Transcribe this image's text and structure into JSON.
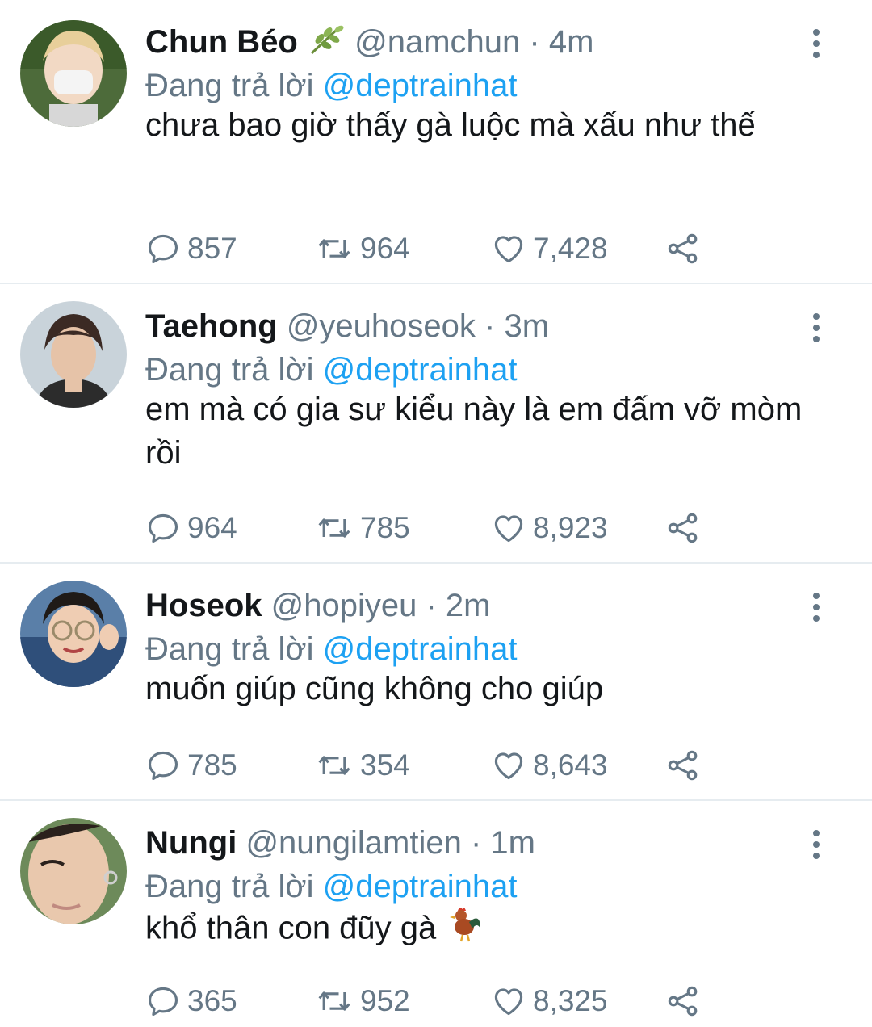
{
  "reply_prefix": "Đang trả lời",
  "tweets": [
    {
      "name": "Chun Béo",
      "name_emoji": "herb-emoji",
      "handle": "@namchun",
      "time": "· 4m",
      "mention": "@deptrainhat",
      "text": "chưa bao giờ thấy gà luộc mà xấu như thế",
      "replies": "857",
      "retweets": "964",
      "likes": "7,428"
    },
    {
      "name": "Taehong",
      "handle": "@yeuhoseok",
      "time": "· 3m",
      "mention": "@deptrainhat",
      "text": "em mà có gia sư kiểu này là em đấm vỡ mòm rồi",
      "replies": "964",
      "retweets": "785",
      "likes": "8,923"
    },
    {
      "name": "Hoseok",
      "handle": "@hopiyeu",
      "time": "· 2m",
      "mention": "@deptrainhat",
      "text": "muốn giúp cũng không cho giúp",
      "replies": "785",
      "retweets": "354",
      "likes": "8,643"
    },
    {
      "name": "Nungi",
      "handle": "@nungilamtien",
      "time": "· 1m",
      "mention": "@deptrainhat",
      "text": "khổ thân con đũy gà",
      "text_emoji": "rooster-emoji",
      "replies": "365",
      "retweets": "952",
      "likes": "8,325"
    }
  ],
  "colors": {
    "text": "#14171a",
    "secondary": "#657786",
    "link": "#1da1f2",
    "divider": "#e6ecf0"
  }
}
